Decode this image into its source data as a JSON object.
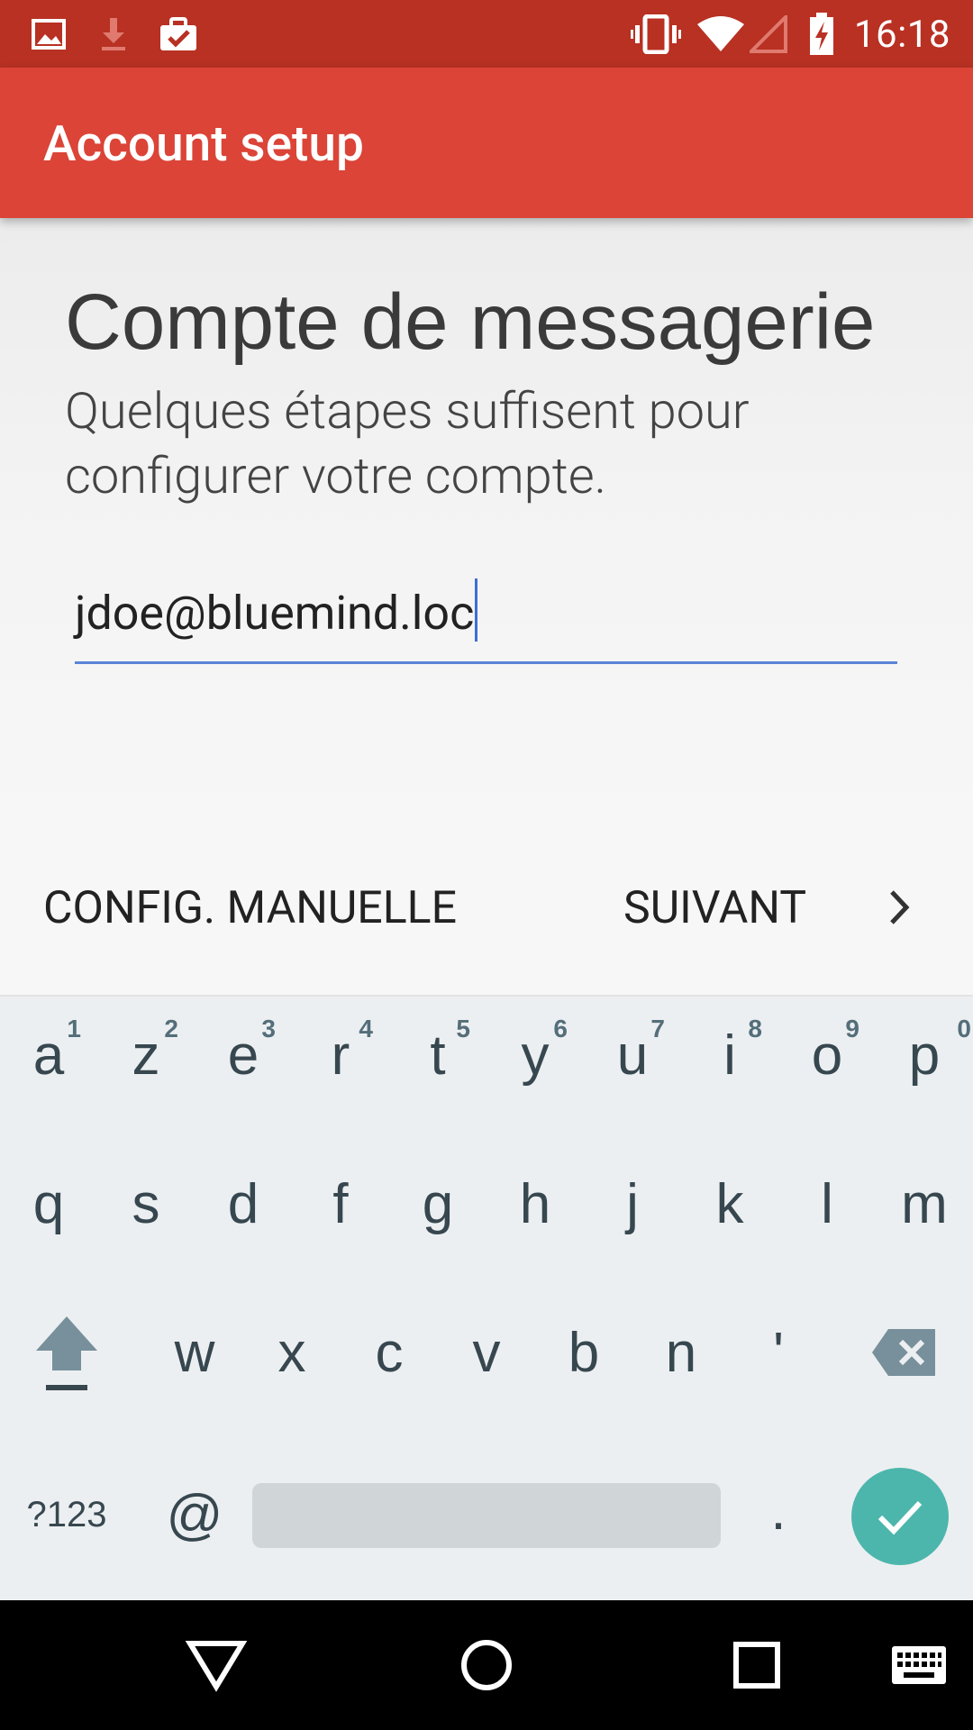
{
  "status_bar": {
    "time": "16:18",
    "icons": [
      "image-icon",
      "download-icon",
      "clipboard-check-icon",
      "vibrate-icon",
      "wifi-icon",
      "signal-icon",
      "battery-charging-icon"
    ]
  },
  "app_bar": {
    "title": "Account setup"
  },
  "content": {
    "heading": "Compte de messagerie",
    "subtitle": "Quelques étapes suffisent pour configurer votre compte.",
    "email_value": "jdoe@bluemind.loc"
  },
  "buttons": {
    "manual": "CONFIG. MANUELLE",
    "next": "SUIVANT"
  },
  "keyboard": {
    "row1": [
      "a",
      "z",
      "e",
      "r",
      "t",
      "y",
      "u",
      "i",
      "o",
      "p"
    ],
    "row1_hints": [
      "1",
      "2",
      "3",
      "4",
      "5",
      "6",
      "7",
      "8",
      "9",
      "0"
    ],
    "row2": [
      "q",
      "s",
      "d",
      "f",
      "g",
      "h",
      "j",
      "k",
      "l",
      "m"
    ],
    "row3": [
      "w",
      "x",
      "c",
      "v",
      "b",
      "n",
      "'"
    ],
    "symbols_key": "?123",
    "at_key": "@",
    "period_key": "."
  },
  "colors": {
    "status_bar": "#b83123",
    "app_bar": "#db4437",
    "accent": "#5a84d8",
    "enter_key": "#4db6ac"
  }
}
